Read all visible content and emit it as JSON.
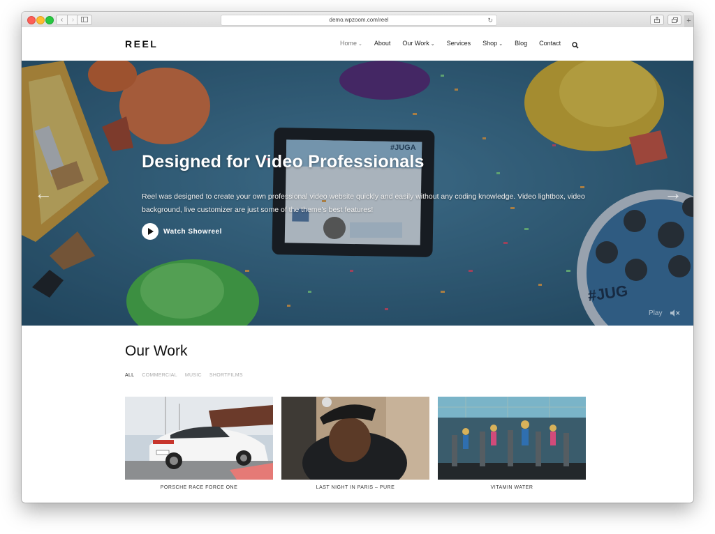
{
  "browser": {
    "url": "demo.wpzoom.com/reel",
    "back_glyph": "‹",
    "forward_glyph": "›",
    "reload_glyph": "↻",
    "new_tab_glyph": "+"
  },
  "site": {
    "logo": "REEL",
    "nav": [
      {
        "label": "Home",
        "dropdown": true,
        "active": true
      },
      {
        "label": "About",
        "dropdown": false
      },
      {
        "label": "Our Work",
        "dropdown": true
      },
      {
        "label": "Services",
        "dropdown": false
      },
      {
        "label": "Shop",
        "dropdown": true
      },
      {
        "label": "Blog",
        "dropdown": false
      },
      {
        "label": "Contact",
        "dropdown": false
      }
    ],
    "chevron_glyph": "⌄"
  },
  "hero": {
    "title": "Designed for Video Professionals",
    "text": "Reel was designed to create your own professional video website quickly and easily without any coding knowledge. Video lightbox, video background, live customizer are just some of the theme’s best features!",
    "cta": "Watch Showreel",
    "play_label": "Play",
    "prev_glyph": "←",
    "next_glyph": "→",
    "tablet_text": "#JUGA",
    "cushion_text": "#JUG"
  },
  "work": {
    "title": "Our Work",
    "filters": [
      "ALL",
      "COMMERCIAL",
      "MUSIC",
      "SHORTFILMS"
    ],
    "items": [
      {
        "title": "PORSCHE RACE FORCE ONE"
      },
      {
        "title": "LAST NIGHT IN PARIS – PURE"
      },
      {
        "title": "VITAMIN WATER"
      }
    ]
  },
  "colors": {
    "hero_bg": "#3f7694",
    "accent_white": "#ffffff"
  }
}
